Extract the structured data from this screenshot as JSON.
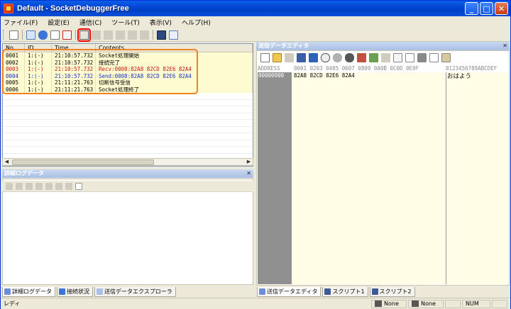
{
  "window": {
    "title": "Default - SocketDebuggerFree",
    "minimize_glyph": "_",
    "maximize_glyph": "□",
    "close_glyph": "✕"
  },
  "menu": [
    "ファイル(F)",
    "設定(E)",
    "通信(C)",
    "ツール(T)",
    "表示(V)",
    "ヘルプ(H)"
  ],
  "log": {
    "columns": [
      "No.",
      "ID",
      "Time",
      "Contents"
    ],
    "rows": [
      {
        "no": "0001",
        "id": "1:(-)",
        "time": "21:10:57.732",
        "contents": "Socket処理開始",
        "kind": "info"
      },
      {
        "no": "0002",
        "id": "1:(-)",
        "time": "21:10:57.732",
        "contents": "接続完了",
        "kind": "info"
      },
      {
        "no": "0003",
        "id": "1:(-)",
        "time": "21:10:57.732",
        "contents": "Recv:0008:82A8 82CD 82E6 82A4",
        "kind": "recv"
      },
      {
        "no": "0004",
        "id": "1:(-)",
        "time": "21:10:57.732",
        "contents": "Send:0008:82A8 82CD 82E6 82A4",
        "kind": "send"
      },
      {
        "no": "0005",
        "id": "1:(-)",
        "time": "21:11:21.763",
        "contents": "切断信号受信",
        "kind": "info"
      },
      {
        "no": "0006",
        "id": "1:(-)",
        "time": "21:11:21.763",
        "contents": "Socket処理終了",
        "kind": "info"
      }
    ]
  },
  "detail_panel": {
    "title": "詳細ログデータ"
  },
  "left_tabs": [
    "詳細ログデータ",
    "接続状況",
    "送信データエクスプローラ"
  ],
  "editor": {
    "title": "送信データエディタ",
    "header_address": "ADDRESS",
    "header_hex": "0001 0203 0405 0607 0809 0A0B 0C0D 0E0F",
    "header_ascii": "0123456789ABCDEF",
    "row_address": "00000000",
    "row_hex": "82A8 82CD 82E6 82A4",
    "row_ascii": "おはよう"
  },
  "right_tabs": [
    "送信データエディタ",
    "スクリプト1",
    "スクリプト2"
  ],
  "status": {
    "left": "レディ",
    "cell1": "None",
    "cell2": "None",
    "num": "NUM"
  },
  "colors": {
    "recv": "#c01818",
    "send": "#1830c0",
    "highlight_box": "#f08020",
    "toolbar_highlight": "#e00000"
  }
}
